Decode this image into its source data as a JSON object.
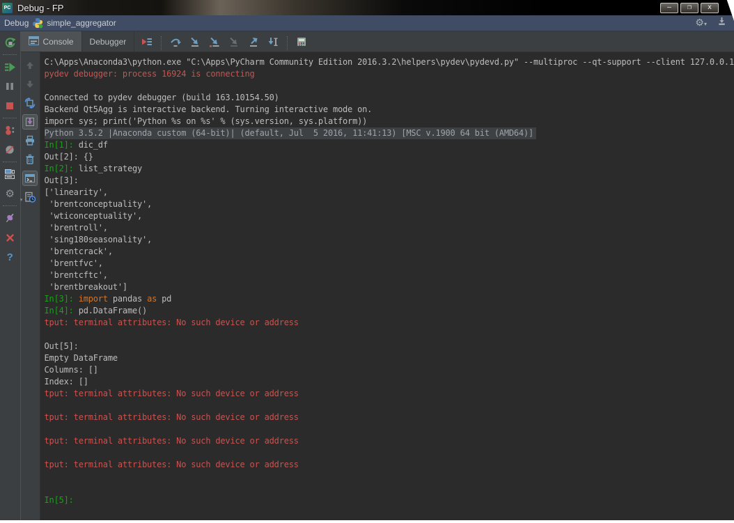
{
  "window": {
    "title": "Debug - FP"
  },
  "titlebar": {
    "app_glyph": "PC",
    "minimize_glyph": "–",
    "maximize_glyph": "❐",
    "close_glyph": "x"
  },
  "debug_header": {
    "label": "Debug",
    "run_config": "simple_aggregator",
    "gear_glyph": "⚙",
    "dropdown_glyph": "▾"
  },
  "tabs": [
    {
      "label": "Console",
      "selected": true
    },
    {
      "label": "Debugger",
      "selected": false
    }
  ],
  "debug_step_icons": [
    "show-execution-point",
    "step-over",
    "step-into",
    "step-into-my-code",
    "force-step-into",
    "step-out",
    "run-to-cursor",
    "evaluate-expression"
  ],
  "left_toolbar_icons": [
    "rerun",
    "resume-program",
    "pause-program",
    "stop",
    "view-breakpoints",
    "mute-breakpoints",
    "restore-layout",
    "settings",
    "pin-tab",
    "close",
    "help"
  ],
  "console_toolbar_icons": [
    "up-the-stack-trace",
    "down-the-stack-trace",
    "use-soft-wraps",
    "scroll-to-end",
    "print",
    "clear-all",
    "show-console-prompt",
    "browse-history"
  ],
  "left_toolbar_glyphs": {
    "gear": "⚙",
    "dropdown": "▾",
    "help": "?"
  },
  "colors": {
    "console_bg": "#2b2b2b",
    "toolbar_bg": "#3c3f41",
    "header_bg": "#3f4c63",
    "accent_blue": "#6e9fc1",
    "error_red": "#c75450",
    "prompt_green": "#16a316",
    "keyword_orange": "#cc7832",
    "run_green": "#499c54"
  },
  "console": {
    "lines": [
      {
        "seg": [
          {
            "s": "d",
            "t": "C:\\Apps\\Anaconda3\\python.exe \"C:\\Apps\\PyCharm Community Edition 2016.3.2\\helpers\\pydev\\pydevd.py\" --multiproc --qt-support --client 127.0.0.1"
          }
        ]
      },
      {
        "seg": [
          {
            "s": "r",
            "t": "pydev debugger: process 16924 is connecting"
          }
        ]
      },
      {
        "seg": []
      },
      {
        "seg": [
          {
            "s": "d",
            "t": "Connected to pydev debugger (build 163.10154.50)"
          }
        ]
      },
      {
        "seg": [
          {
            "s": "d",
            "t": "Backend Qt5Agg is interactive backend. Turning interactive mode on."
          }
        ]
      },
      {
        "seg": [
          {
            "s": "d",
            "t": "import sys; print('Python %s on %s' % (sys.version, sys.platform))"
          }
        ]
      },
      {
        "hl": true,
        "seg": [
          {
            "s": "dim",
            "t": "Python 3.5.2 |Anaconda custom (64-bit)| (default, Jul  5 2016, 11:41:13) [MSC v.1900 64 bit (AMD64)]"
          }
        ]
      },
      {
        "seg": [
          {
            "s": "g",
            "t": "In[1]: "
          },
          {
            "s": "d",
            "t": "dic_df"
          }
        ]
      },
      {
        "seg": [
          {
            "s": "d",
            "t": "Out[2]: {}"
          }
        ]
      },
      {
        "seg": [
          {
            "s": "g",
            "t": "In[2]: "
          },
          {
            "s": "d",
            "t": "list_strategy"
          }
        ]
      },
      {
        "seg": [
          {
            "s": "d",
            "t": "Out[3]:"
          }
        ]
      },
      {
        "seg": [
          {
            "s": "d",
            "t": "['linearity',"
          }
        ]
      },
      {
        "seg": [
          {
            "s": "d",
            "t": " 'brentconceptuality',"
          }
        ]
      },
      {
        "seg": [
          {
            "s": "d",
            "t": " 'wticonceptuality',"
          }
        ]
      },
      {
        "seg": [
          {
            "s": "d",
            "t": " 'brentroll',"
          }
        ]
      },
      {
        "seg": [
          {
            "s": "d",
            "t": " 'sing180seasonality',"
          }
        ]
      },
      {
        "seg": [
          {
            "s": "d",
            "t": " 'brentcrack',"
          }
        ]
      },
      {
        "seg": [
          {
            "s": "d",
            "t": " 'brentfvc',"
          }
        ]
      },
      {
        "seg": [
          {
            "s": "d",
            "t": " 'brentcftc',"
          }
        ]
      },
      {
        "seg": [
          {
            "s": "d",
            "t": " 'brentbreakout']"
          }
        ]
      },
      {
        "seg": [
          {
            "s": "g",
            "t": "In[3]: "
          },
          {
            "s": "o",
            "t": "import"
          },
          {
            "s": "d",
            "t": " pandas "
          },
          {
            "s": "o",
            "t": "as"
          },
          {
            "s": "d",
            "t": " pd"
          }
        ]
      },
      {
        "seg": [
          {
            "s": "g",
            "t": "In[4]: "
          },
          {
            "s": "d",
            "t": "pd.DataFrame()"
          }
        ]
      },
      {
        "seg": [
          {
            "s": "r",
            "t": "tput: terminal attributes: No such device or address"
          }
        ]
      },
      {
        "seg": []
      },
      {
        "seg": [
          {
            "s": "d",
            "t": "Out[5]:"
          }
        ]
      },
      {
        "seg": [
          {
            "s": "d",
            "t": "Empty DataFrame"
          }
        ]
      },
      {
        "seg": [
          {
            "s": "d",
            "t": "Columns: []"
          }
        ]
      },
      {
        "seg": [
          {
            "s": "d",
            "t": "Index: []"
          }
        ]
      },
      {
        "seg": [
          {
            "s": "r",
            "t": "tput: terminal attributes: No such device or address"
          }
        ]
      },
      {
        "seg": []
      },
      {
        "seg": [
          {
            "s": "r",
            "t": "tput: terminal attributes: No such device or address"
          }
        ]
      },
      {
        "seg": []
      },
      {
        "seg": [
          {
            "s": "r",
            "t": "tput: terminal attributes: No such device or address"
          }
        ]
      },
      {
        "seg": []
      },
      {
        "seg": [
          {
            "s": "r",
            "t": "tput: terminal attributes: No such device or address"
          }
        ]
      },
      {
        "seg": []
      },
      {
        "seg": []
      },
      {
        "seg": [
          {
            "s": "g",
            "t": "In[5]: "
          }
        ]
      }
    ]
  }
}
